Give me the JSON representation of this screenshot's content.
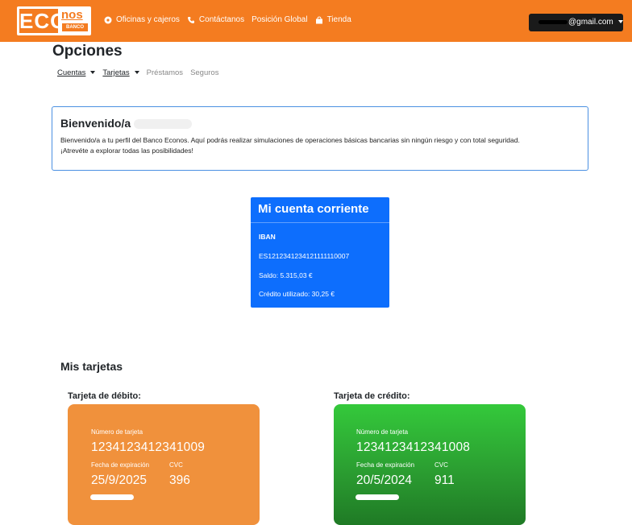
{
  "brand": {
    "eco": "ECO",
    "nos": "nos",
    "banco": "BANCO",
    "color": "#f47c20"
  },
  "nav": [
    {
      "label": "Oficinas y cajeros",
      "icon": "location-icon"
    },
    {
      "label": "Contáctanos",
      "icon": "phone-icon"
    },
    {
      "label": "Posición Global",
      "icon": ""
    },
    {
      "label": "Tienda",
      "icon": "shopping-bag-icon"
    }
  ],
  "account": {
    "email_suffix": "@gmail.com"
  },
  "page": {
    "title": "Opciones"
  },
  "subnav": {
    "cuentas": "Cuentas",
    "tarjetas": "Tarjetas",
    "prestamos": "Préstamos",
    "seguros": "Seguros"
  },
  "welcome": {
    "heading": "Bienvenido/a",
    "line1": "Bienvenido/a a tu perfil del Banco Econos. Aquí podrás realizar simulaciones de operaciones básicas bancarias sin ningún riesgo y con total seguridad.",
    "line2": "¡Atrevéte a explorar todas las posibilidades!"
  },
  "current_account": {
    "title": "Mi cuenta corriente",
    "iban_label": "IBAN",
    "iban": "ES1212341234121111110007",
    "saldo": "Saldo: 5.315,03 €",
    "credito": "Crédito utilizado: 30,25 €",
    "color": "#0d6efd"
  },
  "cards_section": {
    "title": "Mis tarjetas"
  },
  "debit": {
    "label": "Tarjeta de débito:",
    "number_label": "Número de tarjeta",
    "number": "1234123412341009",
    "expiry_label": "Fecha de expiración",
    "cvc_label": "CVC",
    "expiry": "25/9/2025",
    "cvc": "396",
    "color": "#f0913c"
  },
  "credit": {
    "label": "Tarjeta de crédito:",
    "number_label": "Número de tarjeta",
    "number": "1234123412341008",
    "expiry_label": "Fecha de expiración",
    "cvc_label": "CVC",
    "expiry": "20/5/2024",
    "cvc": "911",
    "color": "#2a9a30"
  }
}
